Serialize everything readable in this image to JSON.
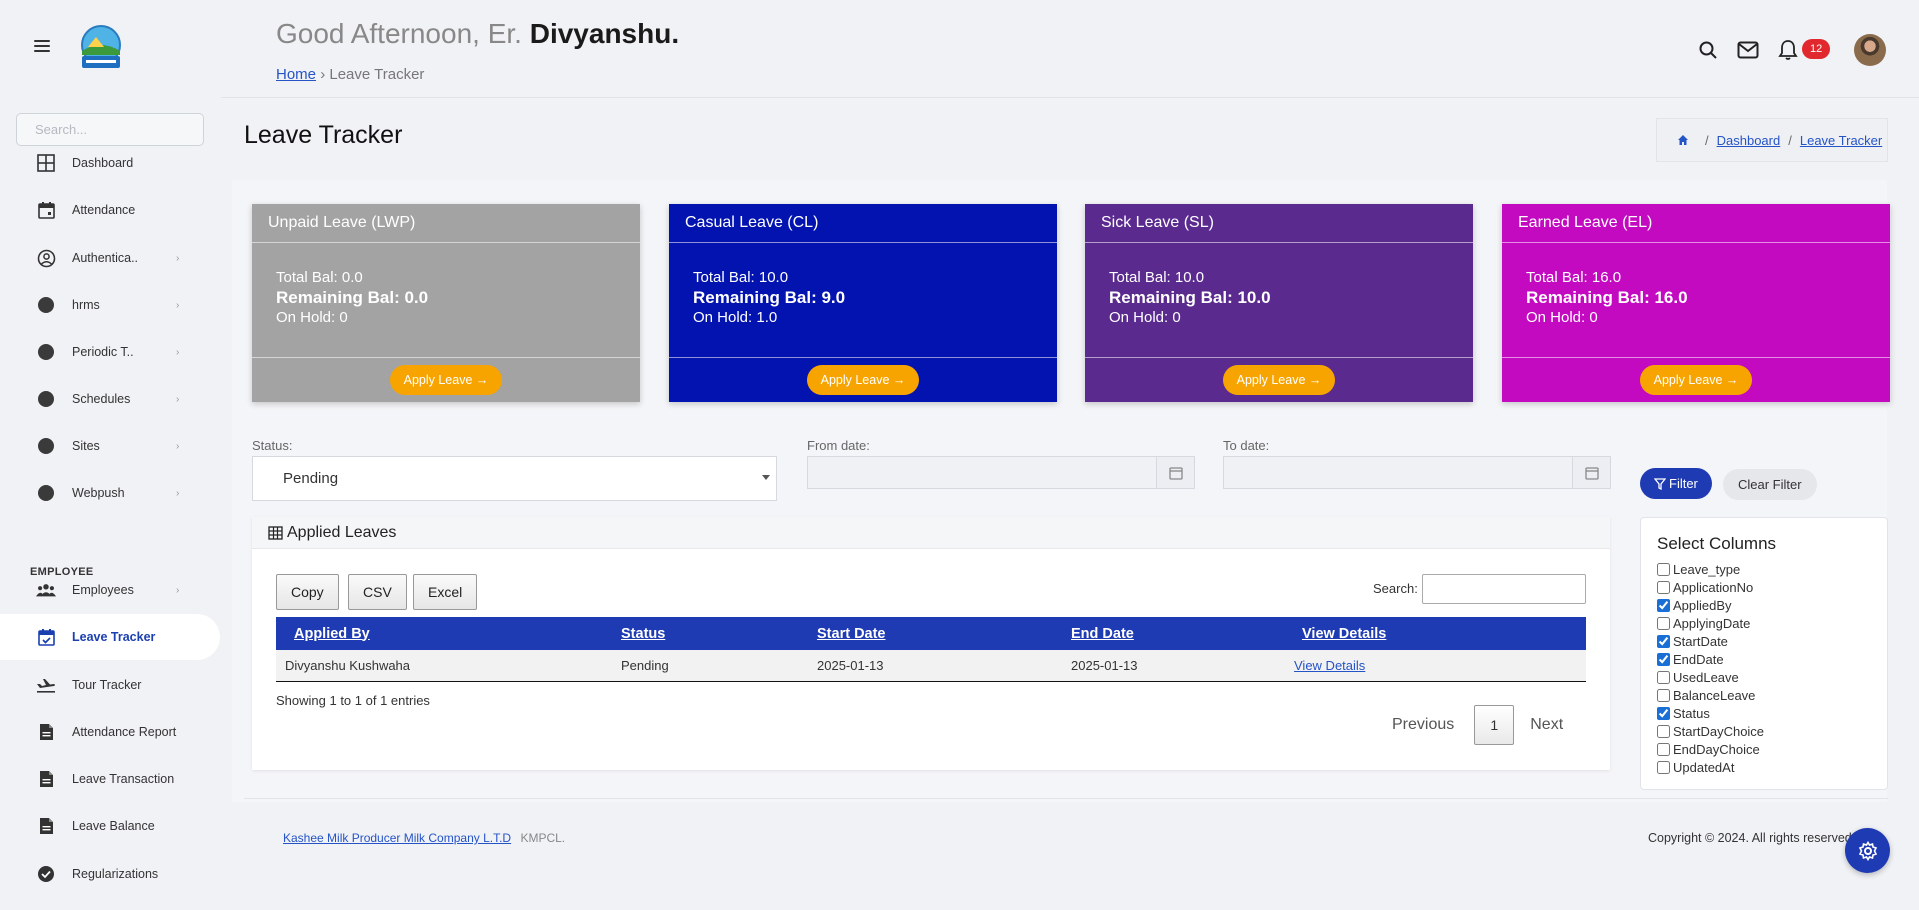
{
  "sidebar": {
    "search_placeholder": "Search...",
    "section_employee": "EMPLOYEE",
    "items": [
      {
        "label": "Dashboard",
        "icon": "dashboard-grid-icon",
        "chevron": false
      },
      {
        "label": "Attendance",
        "icon": "calendar-icon",
        "chevron": false
      },
      {
        "label": "Authentica..",
        "icon": "user-circle-icon",
        "chevron": true
      },
      {
        "label": "hrms",
        "icon": "dot-icon",
        "chevron": true
      },
      {
        "label": "Periodic T..",
        "icon": "dot-icon",
        "chevron": true
      },
      {
        "label": "Schedules",
        "icon": "dot-icon",
        "chevron": true
      },
      {
        "label": "Sites",
        "icon": "dot-icon",
        "chevron": true
      },
      {
        "label": "Webpush",
        "icon": "dot-icon",
        "chevron": true
      },
      {
        "label": "Employees",
        "icon": "users-icon",
        "chevron": true
      },
      {
        "label": "Leave Tracker",
        "icon": "calendar-check-icon",
        "chevron": false,
        "active": true
      },
      {
        "label": "Tour Tracker",
        "icon": "airplane-icon",
        "chevron": false
      },
      {
        "label": "Attendance Report",
        "icon": "document-icon",
        "chevron": false
      },
      {
        "label": "Leave Transaction",
        "icon": "document-icon",
        "chevron": false
      },
      {
        "label": "Leave Balance",
        "icon": "document-icon",
        "chevron": false
      },
      {
        "label": "Regularizations",
        "icon": "check-circle-icon",
        "chevron": false
      }
    ]
  },
  "header": {
    "greeting_prefix": "Good Afternoon, Er.",
    "greeting_name": "Divyanshu.",
    "breadcrumb_home": "Home",
    "breadcrumb_sep": "›",
    "breadcrumb_current": "Leave Tracker",
    "notification_count": "12"
  },
  "page": {
    "title": "Leave Tracker",
    "breadcrumb": {
      "dashboard": "Dashboard",
      "current": "Leave Tracker",
      "sep": "/"
    }
  },
  "leave_cards": [
    {
      "title": "Unpaid Leave (LWP)",
      "total": "Total Bal: 0.0",
      "remaining": "Remaining Bal: 0.0",
      "hold": "On Hold: 0",
      "button": "Apply Leave →",
      "color": "#a3a3a3"
    },
    {
      "title": "Casual Leave (CL)",
      "total": "Total Bal: 10.0",
      "remaining": "Remaining Bal: 9.0",
      "hold": "On Hold: 1.0",
      "button": "Apply Leave →",
      "color": "#0313b0"
    },
    {
      "title": "Sick Leave (SL)",
      "total": "Total Bal: 10.0",
      "remaining": "Remaining Bal: 10.0",
      "hold": "On Hold: 0",
      "button": "Apply Leave →",
      "color": "#5a2a8e"
    },
    {
      "title": "Earned Leave (EL)",
      "total": "Total Bal: 16.0",
      "remaining": "Remaining Bal: 16.0",
      "hold": "On Hold: 0",
      "button": "Apply Leave →",
      "color": "#c30ac0"
    }
  ],
  "filters": {
    "status_label": "Status:",
    "status_value": "Pending",
    "from_label": "From date:",
    "to_label": "To date:",
    "filter_button": "Filter",
    "clear_button": "Clear Filter"
  },
  "applied_leaves": {
    "title": "Applied Leaves",
    "buttons": [
      "Copy",
      "CSV",
      "Excel"
    ],
    "search_label": "Search:",
    "columns": [
      "Applied By",
      "Status",
      "Start Date",
      "End Date",
      "View Details"
    ],
    "rows": [
      {
        "applied_by": "Divyanshu Kushwaha",
        "status": "Pending",
        "start": "2025-01-13",
        "end": "2025-01-13",
        "link": "View Details"
      }
    ],
    "info": "Showing 1 to 1 of 1 entries",
    "prev": "Previous",
    "page": "1",
    "next": "Next"
  },
  "select_columns": {
    "title": "Select Columns",
    "options": [
      {
        "label": "Leave_type",
        "checked": false
      },
      {
        "label": "ApplicationNo",
        "checked": false
      },
      {
        "label": "AppliedBy",
        "checked": true
      },
      {
        "label": "ApplyingDate",
        "checked": false
      },
      {
        "label": "StartDate",
        "checked": true
      },
      {
        "label": "EndDate",
        "checked": true
      },
      {
        "label": "UsedLeave",
        "checked": false
      },
      {
        "label": "BalanceLeave",
        "checked": false
      },
      {
        "label": "Status",
        "checked": true
      },
      {
        "label": "StartDayChoice",
        "checked": false
      },
      {
        "label": "EndDayChoice",
        "checked": false
      },
      {
        "label": "UpdatedAt",
        "checked": false
      }
    ]
  },
  "footer": {
    "company_link": "Kashee Milk Producer Milk Company L.T.D",
    "company_short": "KMPCL.",
    "copyright": "Copyright © 2024. All rights reserved."
  },
  "colors": {
    "primary": "#1f3bb3",
    "accent": "#f7a400",
    "badge": "#e0282e"
  }
}
